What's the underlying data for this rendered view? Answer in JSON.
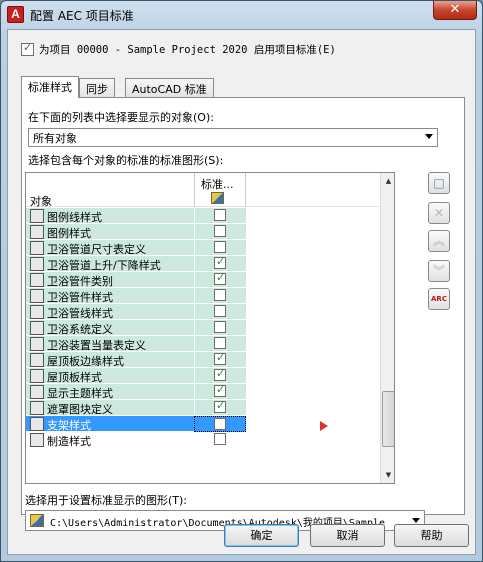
{
  "window": {
    "title": "配置 AEC 项目标准",
    "close_glyph": "✕",
    "app_icon_letter": "A"
  },
  "enable_checkbox": {
    "label": "为项目 00000 - Sample Project 2020 启用项目标准(E)",
    "checked": true
  },
  "tabs": [
    {
      "label": "标准样式",
      "active": true
    },
    {
      "label": "同步",
      "active": false
    },
    {
      "label": "AutoCAD 标准",
      "active": false
    }
  ],
  "object_select": {
    "label": "在下面的列表中选择要显示的对象(O):",
    "value": "所有对象"
  },
  "standards_list": {
    "label": "选择包含每个对象的标准的标准图形(S):",
    "columns": [
      "对象",
      "标准..."
    ],
    "rows": [
      {
        "name": "图例线样式",
        "icon": "legend-line-icon",
        "checked": false
      },
      {
        "name": "图例样式",
        "icon": "legend-icon",
        "checked": false
      },
      {
        "name": "卫浴管道尺寸表定义",
        "icon": "table-icon",
        "checked": false
      },
      {
        "name": "卫浴管道上升/下降样式",
        "icon": "rise-drop-icon",
        "checked": true
      },
      {
        "name": "卫浴管件类别",
        "icon": "fitting-category-icon",
        "checked": true
      },
      {
        "name": "卫浴管件样式",
        "icon": "fitting-icon",
        "checked": false
      },
      {
        "name": "卫浴管线样式",
        "icon": "pipe-line-icon",
        "checked": false
      },
      {
        "name": "卫浴系统定义",
        "icon": "system-icon",
        "checked": false
      },
      {
        "name": "卫浴装置当量表定义",
        "icon": "table-icon",
        "checked": false
      },
      {
        "name": "屋顶板边缘样式",
        "icon": "roof-edge-icon",
        "checked": true
      },
      {
        "name": "屋顶板样式",
        "icon": "roof-slab-icon",
        "checked": true
      },
      {
        "name": "显示主题样式",
        "icon": "display-theme-icon",
        "checked": true
      },
      {
        "name": "遮罩图块定义",
        "icon": "mask-block-icon",
        "checked": true
      },
      {
        "name": "支架样式",
        "icon": "hanger-icon",
        "checked": false,
        "selected": true
      },
      {
        "name": "制造样式",
        "icon": "fabrication-icon",
        "checked": false
      }
    ]
  },
  "side_buttons": [
    {
      "name": "add-standard-drawing-button",
      "glyph": "□",
      "enabled": true
    },
    {
      "name": "remove-standard-drawing-button",
      "glyph": "✕",
      "enabled": false
    },
    {
      "name": "move-up-button",
      "glyph": "︽",
      "enabled": false
    },
    {
      "name": "move-down-button",
      "glyph": "︾",
      "enabled": false
    },
    {
      "name": "arc-button",
      "glyph": "ARC",
      "enabled": true
    }
  ],
  "display_drawing": {
    "label": "选择用于设置标准显示的图形(T):",
    "value": "C:\\Users\\Administrator\\Documents\\Autodesk\\我的项目\\Sample"
  },
  "buttons": {
    "ok": "确定",
    "cancel": "取消",
    "help": "帮助"
  }
}
